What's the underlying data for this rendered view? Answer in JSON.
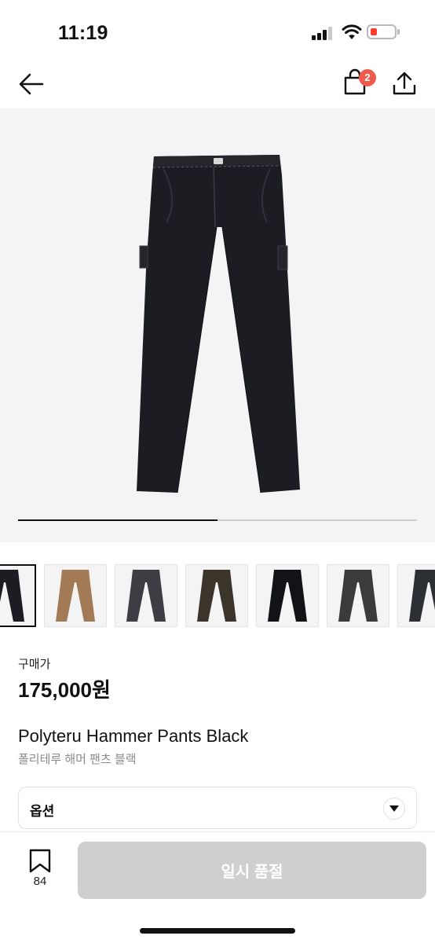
{
  "status_bar": {
    "time": "11:19"
  },
  "nav": {
    "cart_count": "2"
  },
  "gallery": {
    "progress": 0.5,
    "thumbnails": [
      {
        "color": "#1b1d22",
        "selected": true
      },
      {
        "color": "#a27a55",
        "selected": false
      },
      {
        "color": "#3d3e43",
        "selected": false
      },
      {
        "color": "#3a342b",
        "selected": false
      },
      {
        "color": "#121316",
        "selected": false
      },
      {
        "color": "#3b3b3d",
        "selected": false
      },
      {
        "color": "#2c2f34",
        "selected": false
      }
    ]
  },
  "product": {
    "price_label": "구매가",
    "price": "175,000원",
    "name": "Polyteru Hammer Pants Black",
    "name_ko": "폴리테루 해머 팬츠 블랙"
  },
  "option": {
    "label": "옵션"
  },
  "bottom": {
    "bookmark_count": "84",
    "action_label": "일시 품절"
  },
  "colors": {
    "accent_badge": "#ef5a4d",
    "disabled_button": "#cfcfcf"
  }
}
